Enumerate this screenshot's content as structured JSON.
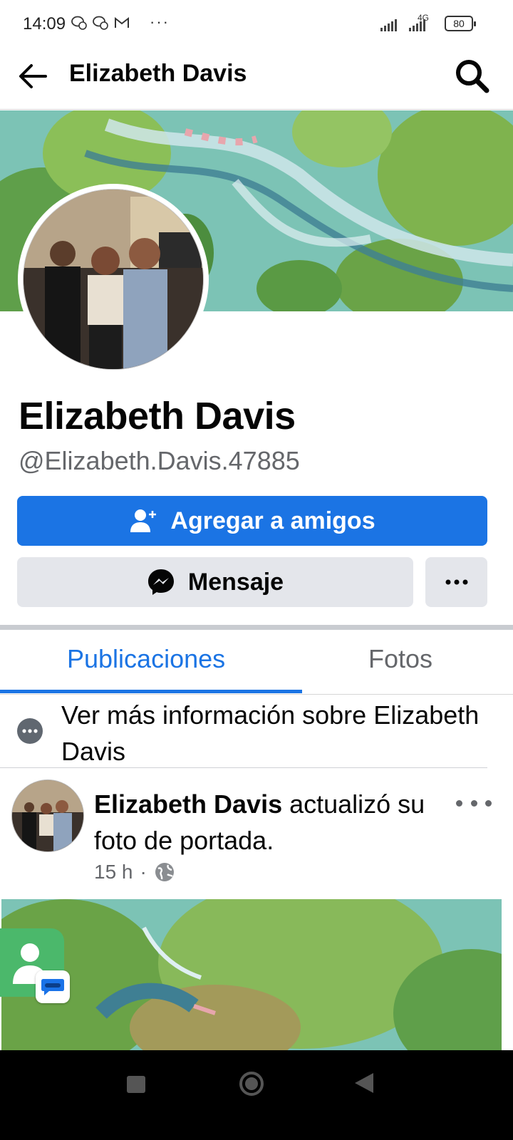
{
  "status_bar": {
    "time": "14:09",
    "network": "4G",
    "battery": "80"
  },
  "header": {
    "title": "Elizabeth Davis",
    "back_icon": "arrow-left-icon",
    "search_icon": "search-icon"
  },
  "profile": {
    "name": "Elizabeth Davis",
    "username": "@Elizabeth.Davis.47885",
    "add_friend_label": "Agregar a amigos",
    "message_label": "Mensaje",
    "accent_color": "#1b74e4"
  },
  "tabs": [
    {
      "label": "Publicaciones",
      "active": true
    },
    {
      "label": "Fotos",
      "active": false
    }
  ],
  "more_info": {
    "text": "Ver más información sobre Elizabeth Davis"
  },
  "post": {
    "author": "Elizabeth Davis",
    "action": " actualizó su foto de portada.",
    "time": "15 h",
    "audience_icon": "globe-icon"
  }
}
